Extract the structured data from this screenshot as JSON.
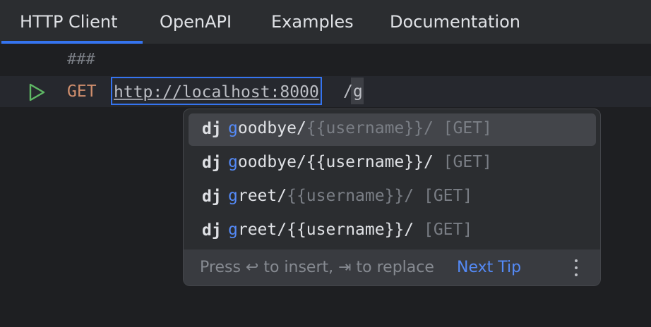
{
  "tabs": [
    {
      "label": "HTTP Client",
      "active": true
    },
    {
      "label": "OpenAPI",
      "active": false
    },
    {
      "label": "Examples",
      "active": false
    },
    {
      "label": "Documentation",
      "active": false
    }
  ],
  "editor": {
    "separator": "###",
    "method": "GET",
    "url": "http://localhost:8000",
    "typed": "/g",
    "run_icon": "play-icon"
  },
  "completion": {
    "items": [
      {
        "prefix": "dj",
        "match": "g",
        "rest": "oodbye/",
        "param": "{{username}}/",
        "method": " [GET]",
        "selected": true,
        "param_dim": true
      },
      {
        "prefix": "dj",
        "match": "g",
        "rest": "oodbye/",
        "param": "{{username}}/",
        "method": " [GET]",
        "selected": false,
        "param_dim": false
      },
      {
        "prefix": "dj",
        "match": "g",
        "rest": "reet/",
        "param": "{{username}}/",
        "method": " [GET]",
        "selected": false,
        "param_dim": true
      },
      {
        "prefix": "dj",
        "match": "g",
        "rest": "reet/",
        "param": "{{username}}/",
        "method": " [GET]",
        "selected": false,
        "param_dim": false
      }
    ],
    "hint": "Press ↩ to insert, ⇥ to replace",
    "next_tip": "Next Tip",
    "more_icon": "more-vertical-icon"
  },
  "colors": {
    "accent": "#3574f0",
    "match": "#548af7",
    "method": "#cf8e6d",
    "run_icon": "#5fb865"
  }
}
